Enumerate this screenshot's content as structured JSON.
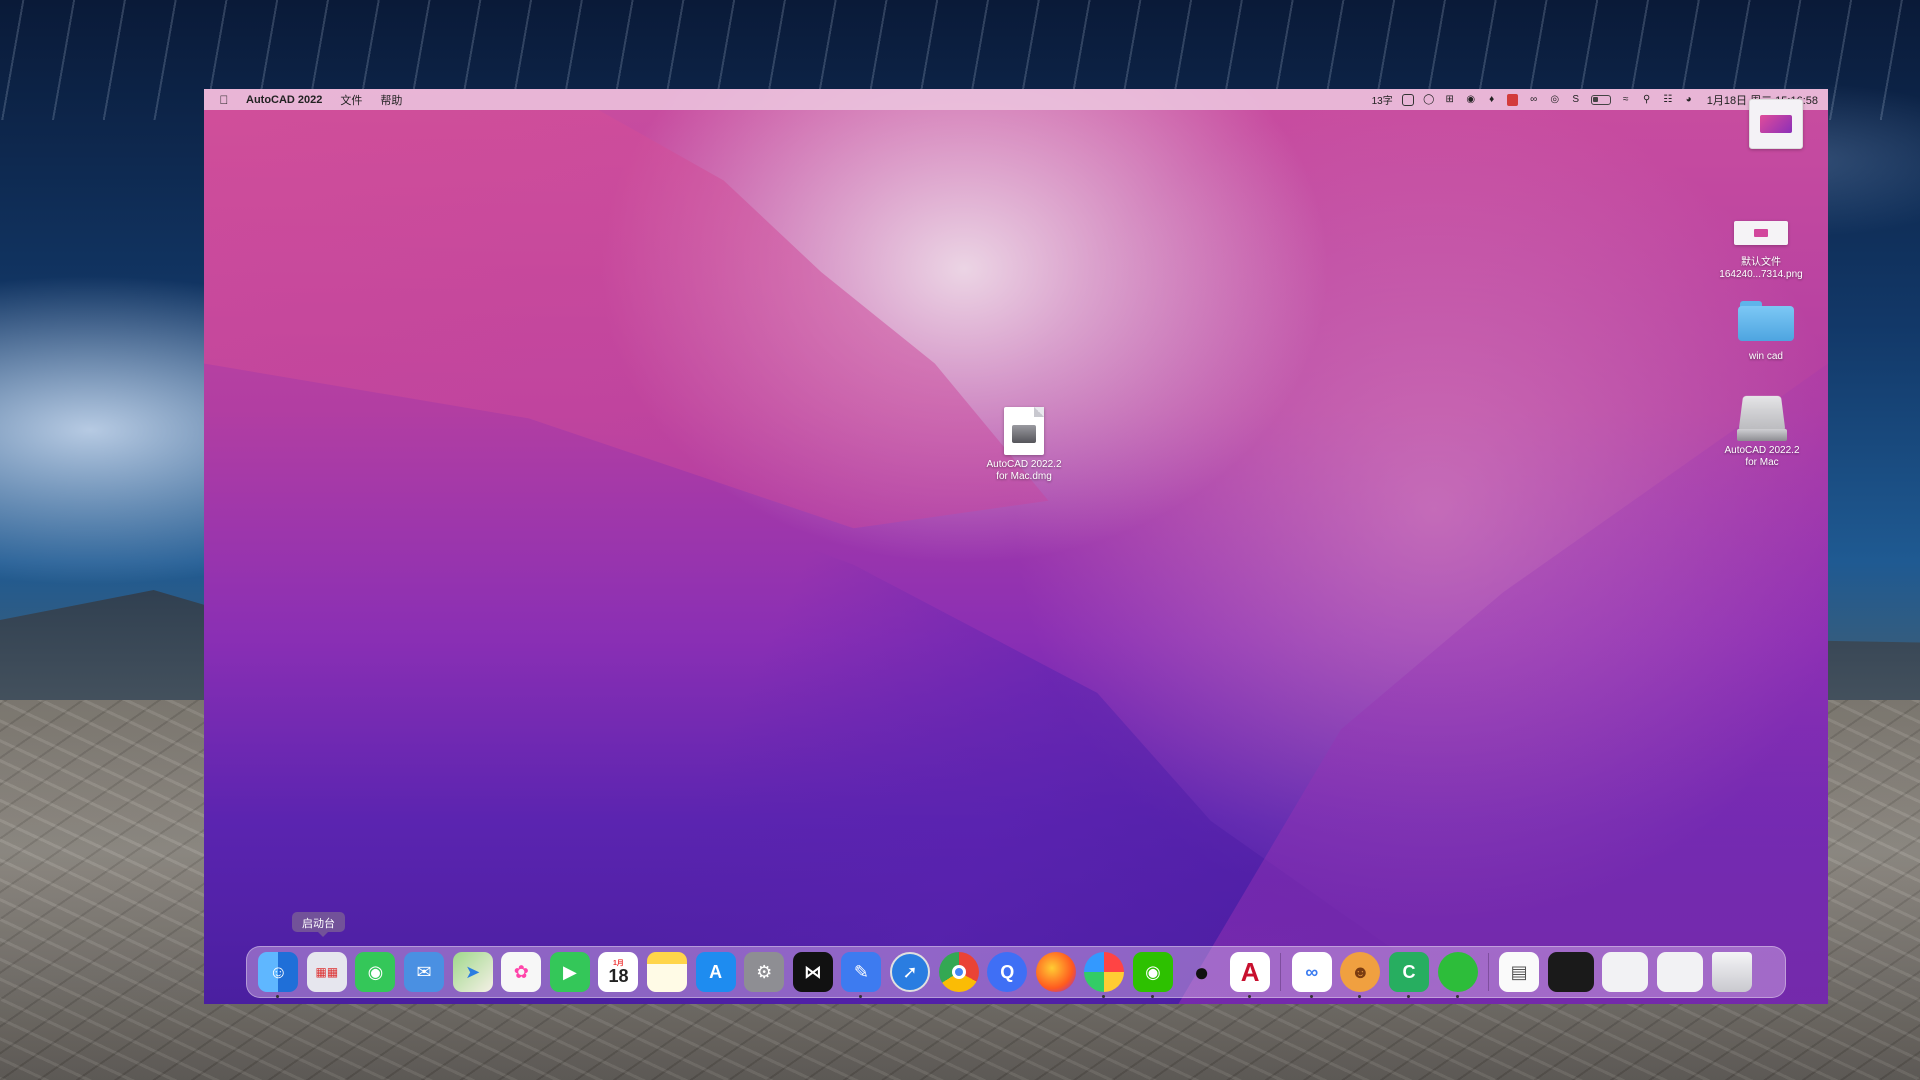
{
  "menubar": {
    "app_name": "AutoCAD 2022",
    "menus": [
      "文件",
      "帮助"
    ],
    "status_text": "13字",
    "datetime": "1月18日 周二 15:16:58"
  },
  "desktop": {
    "center_file": {
      "label_line1": "AutoCAD 2022.2",
      "label_line2": "for Mac.dmg",
      "icon": "dmg-file-icon"
    },
    "right_column": [
      {
        "label_line1": "",
        "label_line2": "",
        "icon": "screenshot-thumbnail"
      },
      {
        "label_line1": "默认文件",
        "label_line2": "164240...7314.png",
        "icon": "png-thumbnail"
      },
      {
        "label_line1": "win cad",
        "label_line2": "",
        "icon": "folder-icon"
      },
      {
        "label_line1": "AutoCAD 2022.2",
        "label_line2": "for Mac",
        "icon": "mounted-disk-icon"
      }
    ]
  },
  "dock": {
    "tooltip": "启动台",
    "calendar_month": "1月",
    "calendar_day": "18",
    "apps": [
      {
        "name": "Finder",
        "icon": "finder-icon",
        "color": "#3b8ff0",
        "running": true
      },
      {
        "name": "Launchpad",
        "icon": "launchpad-icon",
        "color": "#e8e8ee",
        "running": false
      },
      {
        "name": "Messages",
        "icon": "messages-icon",
        "color": "#34c759",
        "running": false
      },
      {
        "name": "Mail",
        "icon": "mail-icon",
        "color": "#4a90e2",
        "running": false
      },
      {
        "name": "Maps",
        "icon": "maps-icon",
        "color": "#7cc46b",
        "running": false
      },
      {
        "name": "Photos",
        "icon": "photos-icon",
        "color": "#f5f5f5",
        "running": false
      },
      {
        "name": "FaceTime",
        "icon": "facetime-icon",
        "color": "#34c759",
        "running": false
      },
      {
        "name": "Calendar",
        "icon": "calendar-icon",
        "color": "#ffffff",
        "running": false
      },
      {
        "name": "Notes",
        "icon": "notes-icon",
        "color": "#ffd54a",
        "running": false
      },
      {
        "name": "App Store",
        "icon": "appstore-icon",
        "color": "#1e8cf0",
        "running": false
      },
      {
        "name": "System Preferences",
        "icon": "settings-icon",
        "color": "#8e8e93",
        "running": false
      },
      {
        "name": "CapCut",
        "icon": "capcut-icon",
        "color": "#111111",
        "running": false
      },
      {
        "name": "Pen",
        "icon": "pen-icon",
        "color": "#3d7bf0",
        "running": true
      },
      {
        "name": "Safari",
        "icon": "safari-icon",
        "color": "#2a7de1",
        "running": false
      },
      {
        "name": "Chrome",
        "icon": "chrome-icon",
        "color": "#ffffff",
        "running": false
      },
      {
        "name": "Quark",
        "icon": "search-app-icon",
        "color": "#3f6ff5",
        "running": false
      },
      {
        "name": "Firefox",
        "icon": "firefox-icon",
        "color": "#ff7139",
        "running": false
      },
      {
        "name": "Color App",
        "icon": "colorwheel-icon",
        "color": "#4f8ef7",
        "running": true
      },
      {
        "name": "WeChat",
        "icon": "wechat-icon",
        "color": "#2dc100",
        "running": true
      },
      {
        "name": "QQ",
        "icon": "qq-icon",
        "color": "#111111",
        "running": false
      },
      {
        "name": "AutoCAD",
        "icon": "autocad-icon",
        "color": "#c8102e",
        "running": true
      },
      {
        "name": "Baidu Netdisk",
        "icon": "cloud-rings-icon",
        "color": "#ffffff",
        "running": true
      },
      {
        "name": "Monkey",
        "icon": "monkey-icon",
        "color": "#f0a040",
        "running": true
      },
      {
        "name": "Camtasia",
        "icon": "camtasia-icon",
        "color": "#27ae60",
        "running": true
      },
      {
        "name": "Green App",
        "icon": "green-circle-icon",
        "color": "#2dbd3a",
        "running": true
      }
    ],
    "recent": [
      {
        "name": "Downloads document",
        "icon": "document-icon"
      },
      {
        "name": "Screen recording",
        "icon": "recording-thumbnail"
      },
      {
        "name": "Window preview 1",
        "icon": "window-thumbnail"
      },
      {
        "name": "Window preview 2",
        "icon": "window-thumbnail"
      },
      {
        "name": "Trash",
        "icon": "trash-icon"
      }
    ]
  }
}
